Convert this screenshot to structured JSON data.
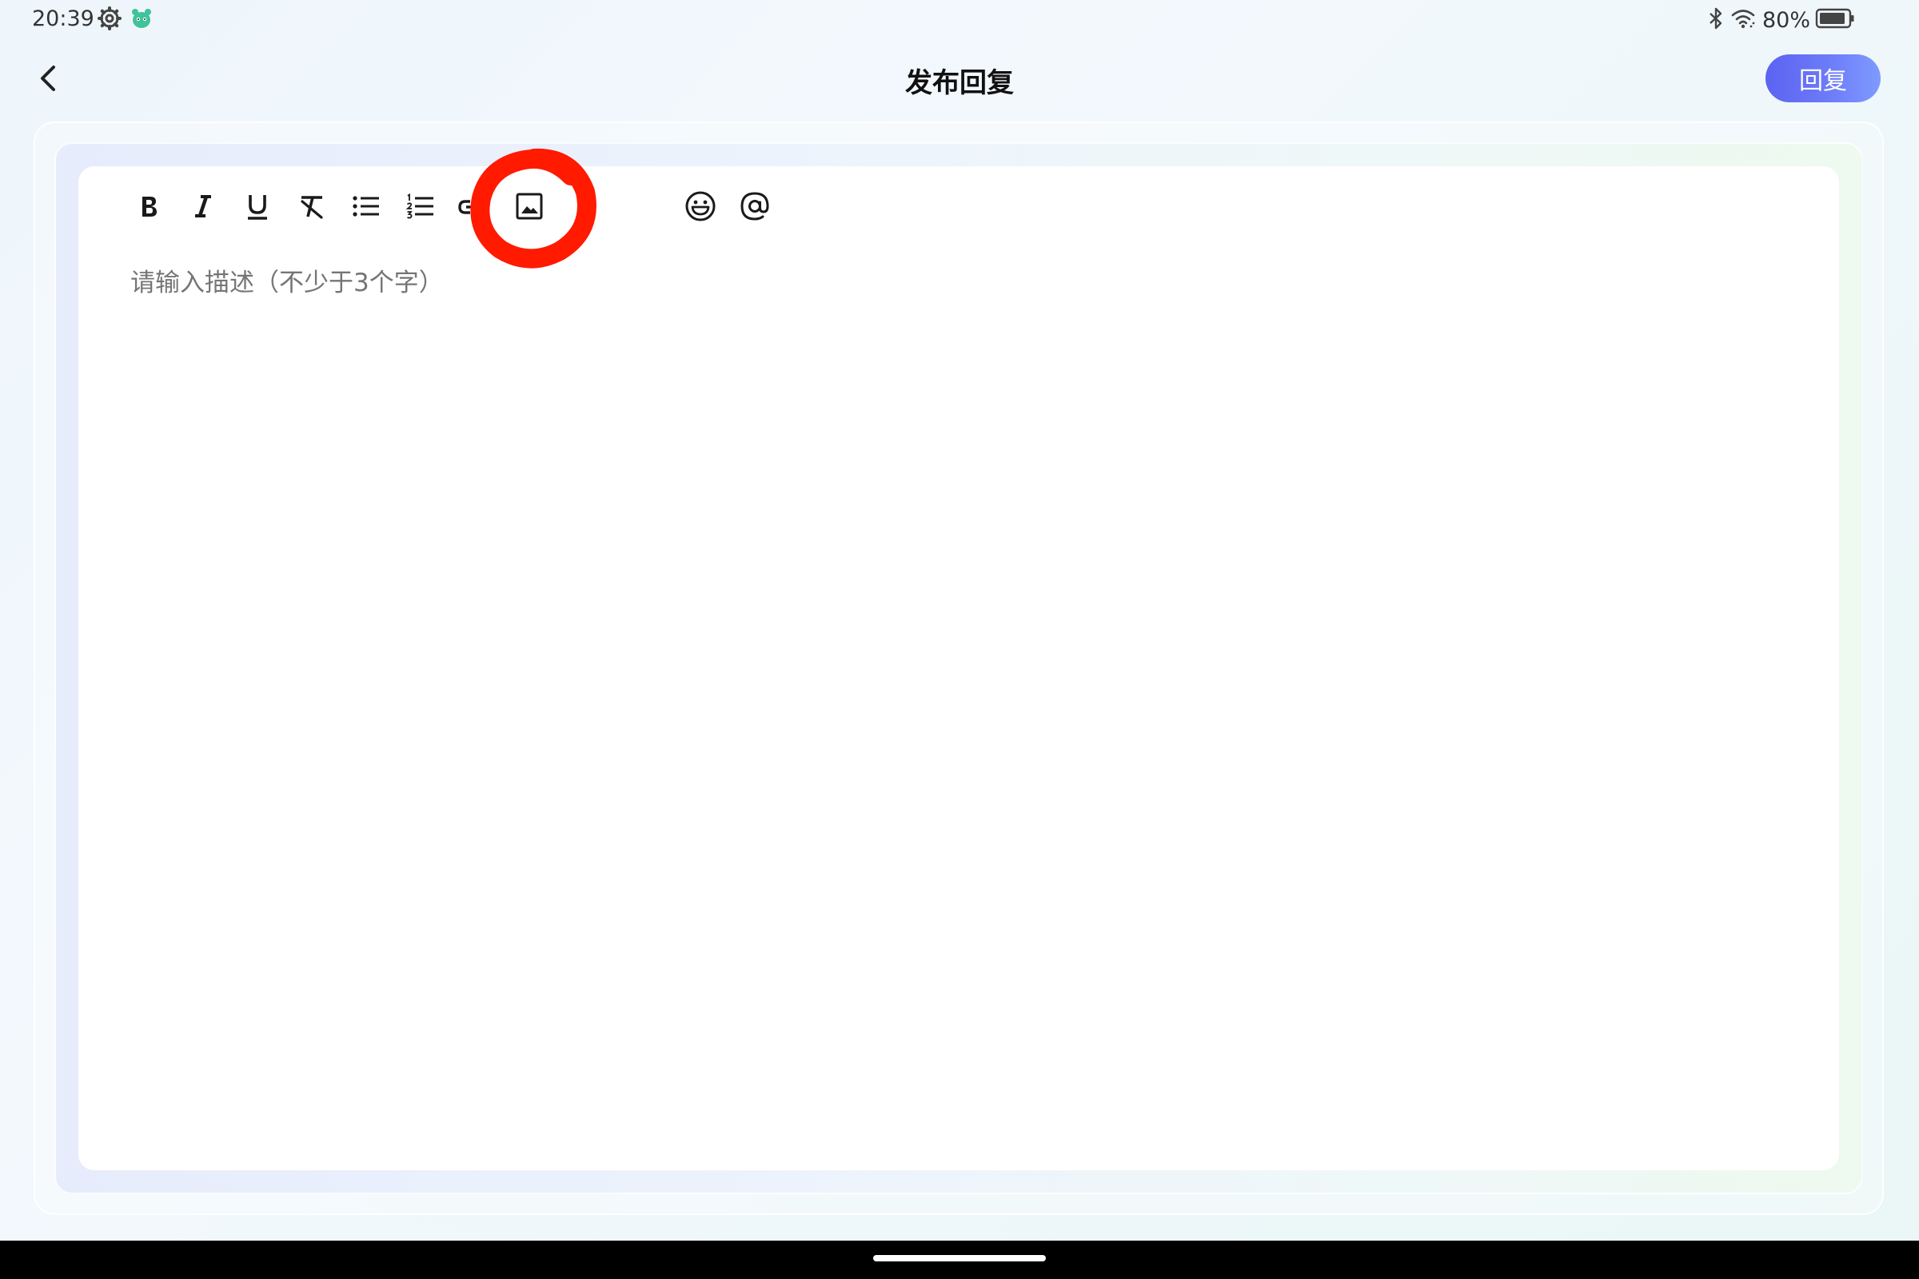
{
  "status_bar": {
    "time": "20:39",
    "left_icons": [
      "gear-icon",
      "app-mascot-icon"
    ],
    "right_icons": [
      "bluetooth-icon",
      "wifi-icon",
      "battery-icon"
    ],
    "battery": "80%"
  },
  "header": {
    "title": "发布回复",
    "back_icon": "chevron-left-icon",
    "reply_label": "回复"
  },
  "editor": {
    "placeholder": "请输入描述（不少于3个字）",
    "value": "",
    "toolbar": [
      {
        "name": "bold-button",
        "icon": "bold-icon"
      },
      {
        "name": "italic-button",
        "icon": "italic-icon"
      },
      {
        "name": "underline-button",
        "icon": "underline-icon"
      },
      {
        "name": "clear-format-button",
        "icon": "clear-format-icon"
      },
      {
        "name": "bullet-list-button",
        "icon": "bullet-list-icon"
      },
      {
        "name": "numbered-list-button",
        "icon": "numbered-list-icon"
      },
      {
        "name": "link-button",
        "icon": "link-icon"
      },
      {
        "name": "image-button",
        "icon": "image-icon"
      },
      {
        "name": "emoji-button",
        "icon": "emoji-icon"
      },
      {
        "name": "mention-button",
        "icon": "at-sign-icon"
      }
    ]
  },
  "colors": {
    "reply_button_start": "#5b63f2",
    "reply_button_end": "#7e9bff",
    "annotation": "#ff1a00",
    "placeholder": "#9a9a9a",
    "icon": "#1a1a1a"
  }
}
